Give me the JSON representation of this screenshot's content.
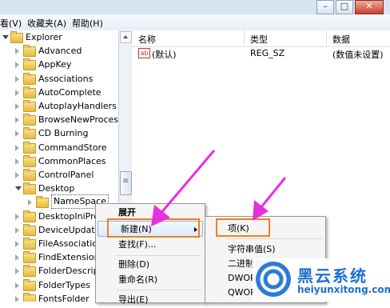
{
  "menubar": {
    "items": [
      "看(V)",
      "收藏夹(A)",
      "帮助(H)"
    ]
  },
  "window_controls": {
    "minimize": "–",
    "maximize": "□",
    "close": "✕"
  },
  "tree": {
    "items": [
      {
        "label": "Explorer",
        "expanded": true
      },
      {
        "label": "Advanced"
      },
      {
        "label": "AppKey"
      },
      {
        "label": "Associations"
      },
      {
        "label": "AutoComplete"
      },
      {
        "label": "AutoplayHandlers"
      },
      {
        "label": "BrowseNewProcess"
      },
      {
        "label": "CD Burning"
      },
      {
        "label": "CommandStore"
      },
      {
        "label": "CommonPlaces"
      },
      {
        "label": "ControlPanel"
      },
      {
        "label": "Desktop",
        "expanded": true
      },
      {
        "label": "NameSpace",
        "selected": true
      },
      {
        "label": "DesktopIniProp"
      },
      {
        "label": "DeviceUpdateL"
      },
      {
        "label": "FileAssociation"
      },
      {
        "label": "FindExtensions"
      },
      {
        "label": "FolderDescript"
      },
      {
        "label": "FolderTypes"
      },
      {
        "label": "FontsFolder"
      }
    ]
  },
  "list": {
    "columns": [
      "名称",
      "类型",
      "数据"
    ],
    "rows": [
      {
        "icon": "ab",
        "name": "(默认)",
        "type": "REG_SZ",
        "data": "(数值未设置)"
      }
    ]
  },
  "context_menu": {
    "items": [
      "展开",
      "新建(N)",
      "查找(F)...",
      "删除(D)",
      "重命名(R)",
      "导出(E)"
    ]
  },
  "submenu": {
    "items": [
      "项(K)",
      "字符串值(S)",
      "二进制值(B)",
      "DWORD",
      "QWORD"
    ]
  },
  "watermark": {
    "title": "黑云系统",
    "url": "heiyunxitong.com"
  },
  "colors": {
    "highlight_box": "#f07f1f",
    "pointer_arrow": "#e62fe0",
    "brand": "#1e6fd0"
  }
}
